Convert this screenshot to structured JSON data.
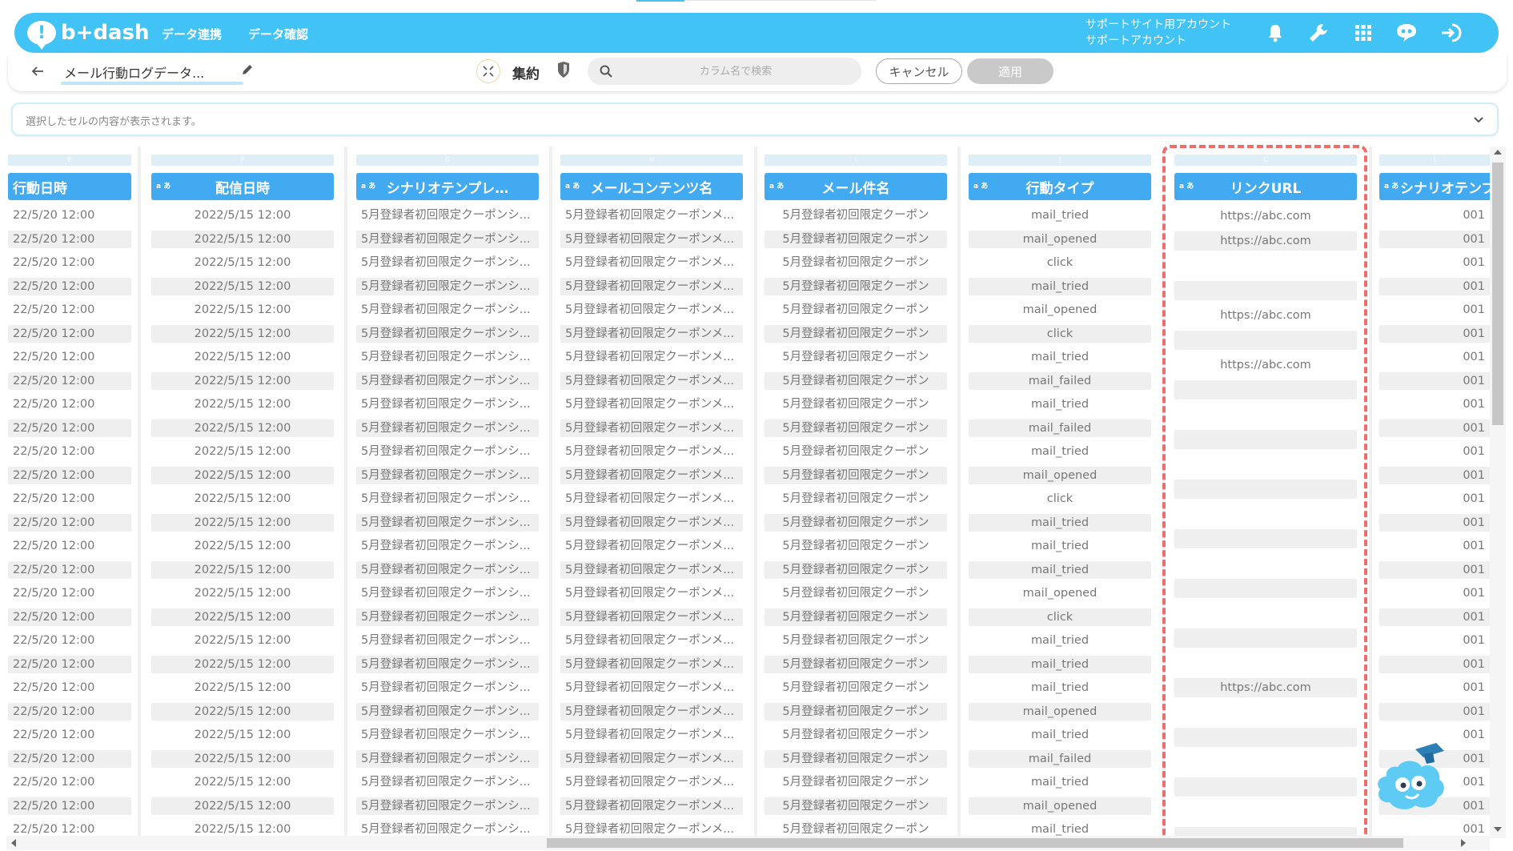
{
  "app": {
    "logo_text": "b+dash",
    "nav": [
      "データ連携",
      "データ確認"
    ],
    "account_line1": "サポートサイト用アカウント",
    "account_line2": "サポートアカウント"
  },
  "toolbar": {
    "title": "メール行動ログデータ...",
    "aggregate_label": "集約",
    "search_placeholder": "カラム名で検索",
    "cancel_label": "キャンセル",
    "apply_label": "適用"
  },
  "cell_viewer": {
    "placeholder": "選択したセルの内容が表示されます。"
  },
  "grid": {
    "type_badge": "a あ",
    "columns": [
      {
        "letter": "E",
        "name": "行動日時"
      },
      {
        "letter": "F",
        "name": "配信日時"
      },
      {
        "letter": "G",
        "name": "シナリオテンプレ…"
      },
      {
        "letter": "H",
        "name": "メールコンテンツ名"
      },
      {
        "letter": "I",
        "name": "メール件名"
      },
      {
        "letter": "J",
        "name": "行動タイプ"
      },
      {
        "letter": "C",
        "name": "リンクURL"
      },
      {
        "letter": "L",
        "name": "シナリオテンプ"
      }
    ],
    "rows": [
      [
        "22/5/20 12:00",
        "2022/5/15 12:00",
        "5月登録者初回限定クーポンシ...",
        "5月登録者初回限定クーポンメ...",
        "5月登録者初回限定クーポン",
        "mail_tried",
        "https://abc.com",
        "001"
      ],
      [
        "22/5/20 12:00",
        "2022/5/15 12:00",
        "5月登録者初回限定クーポンシ...",
        "5月登録者初回限定クーポンメ...",
        "5月登録者初回限定クーポン",
        "mail_opened",
        "https://abc.com",
        "001"
      ],
      [
        "22/5/20 12:00",
        "2022/5/15 12:00",
        "5月登録者初回限定クーポンシ...",
        "5月登録者初回限定クーポンメ...",
        "5月登録者初回限定クーポン",
        "click",
        "",
        "001"
      ],
      [
        "22/5/20 12:00",
        "2022/5/15 12:00",
        "5月登録者初回限定クーポンシ...",
        "5月登録者初回限定クーポンメ...",
        "5月登録者初回限定クーポン",
        "mail_tried",
        "",
        "001"
      ],
      [
        "22/5/20 12:00",
        "2022/5/15 12:00",
        "5月登録者初回限定クーポンシ...",
        "5月登録者初回限定クーポンメ...",
        "5月登録者初回限定クーポン",
        "mail_opened",
        "https://abc.com",
        "001"
      ],
      [
        "22/5/20 12:00",
        "2022/5/15 12:00",
        "5月登録者初回限定クーポンシ...",
        "5月登録者初回限定クーポンメ...",
        "5月登録者初回限定クーポン",
        "click",
        "",
        "001"
      ],
      [
        "22/5/20 12:00",
        "2022/5/15 12:00",
        "5月登録者初回限定クーポンシ...",
        "5月登録者初回限定クーポンメ...",
        "5月登録者初回限定クーポン",
        "mail_tried",
        "https://abc.com",
        "001"
      ],
      [
        "22/5/20 12:00",
        "2022/5/15 12:00",
        "5月登録者初回限定クーポンシ...",
        "5月登録者初回限定クーポンメ...",
        "5月登録者初回限定クーポン",
        "mail_failed",
        "",
        "001"
      ],
      [
        "22/5/20 12:00",
        "2022/5/15 12:00",
        "5月登録者初回限定クーポンシ...",
        "5月登録者初回限定クーポンメ...",
        "5月登録者初回限定クーポン",
        "mail_tried",
        "",
        "001"
      ],
      [
        "22/5/20 12:00",
        "2022/5/15 12:00",
        "5月登録者初回限定クーポンシ...",
        "5月登録者初回限定クーポンメ...",
        "5月登録者初回限定クーポン",
        "mail_failed",
        "",
        "001"
      ],
      [
        "22/5/20 12:00",
        "2022/5/15 12:00",
        "5月登録者初回限定クーポンシ...",
        "5月登録者初回限定クーポンメ...",
        "5月登録者初回限定クーポン",
        "mail_tried",
        "",
        "001"
      ],
      [
        "22/5/20 12:00",
        "2022/5/15 12:00",
        "5月登録者初回限定クーポンシ...",
        "5月登録者初回限定クーポンメ...",
        "5月登録者初回限定クーポン",
        "mail_opened",
        "",
        "001"
      ],
      [
        "22/5/20 12:00",
        "2022/5/15 12:00",
        "5月登録者初回限定クーポンシ...",
        "5月登録者初回限定クーポンメ...",
        "5月登録者初回限定クーポン",
        "click",
        "",
        "001"
      ],
      [
        "22/5/20 12:00",
        "2022/5/15 12:00",
        "5月登録者初回限定クーポンシ...",
        "5月登録者初回限定クーポンメ...",
        "5月登録者初回限定クーポン",
        "mail_tried",
        "",
        "001"
      ],
      [
        "22/5/20 12:00",
        "2022/5/15 12:00",
        "5月登録者初回限定クーポンシ...",
        "5月登録者初回限定クーポンメ...",
        "5月登録者初回限定クーポン",
        "mail_tried",
        "",
        "001"
      ],
      [
        "22/5/20 12:00",
        "2022/5/15 12:00",
        "5月登録者初回限定クーポンシ...",
        "5月登録者初回限定クーポンメ...",
        "5月登録者初回限定クーポン",
        "mail_tried",
        "",
        "001"
      ],
      [
        "22/5/20 12:00",
        "2022/5/15 12:00",
        "5月登録者初回限定クーポンシ...",
        "5月登録者初回限定クーポンメ...",
        "5月登録者初回限定クーポン",
        "mail_opened",
        "",
        "001"
      ],
      [
        "22/5/20 12:00",
        "2022/5/15 12:00",
        "5月登録者初回限定クーポンシ...",
        "5月登録者初回限定クーポンメ...",
        "5月登録者初回限定クーポン",
        "click",
        "",
        "001"
      ],
      [
        "22/5/20 12:00",
        "2022/5/15 12:00",
        "5月登録者初回限定クーポンシ...",
        "5月登録者初回限定クーポンメ...",
        "5月登録者初回限定クーポン",
        "mail_tried",
        "",
        "001"
      ],
      [
        "22/5/20 12:00",
        "2022/5/15 12:00",
        "5月登録者初回限定クーポンシ...",
        "5月登録者初回限定クーポンメ...",
        "5月登録者初回限定クーポン",
        "mail_tried",
        "https://abc.com",
        "001"
      ],
      [
        "22/5/20 12:00",
        "2022/5/15 12:00",
        "5月登録者初回限定クーポンシ...",
        "5月登録者初回限定クーポンメ...",
        "5月登録者初回限定クーポン",
        "mail_tried",
        "",
        "001"
      ],
      [
        "22/5/20 12:00",
        "2022/5/15 12:00",
        "5月登録者初回限定クーポンシ...",
        "5月登録者初回限定クーポンメ...",
        "5月登録者初回限定クーポン",
        "mail_opened",
        "",
        "001"
      ],
      [
        "22/5/20 12:00",
        "2022/5/15 12:00",
        "5月登録者初回限定クーポンシ...",
        "5月登録者初回限定クーポンメ...",
        "5月登録者初回限定クーポン",
        "mail_tried",
        "",
        "001"
      ],
      [
        "22/5/20 12:00",
        "2022/5/15 12:00",
        "5月登録者初回限定クーポンシ...",
        "5月登録者初回限定クーポンメ...",
        "5月登録者初回限定クーポン",
        "mail_failed",
        "",
        "001"
      ],
      [
        "22/5/20 12:00",
        "2022/5/15 12:00",
        "5月登録者初回限定クーポンシ...",
        "5月登録者初回限定クーポンメ...",
        "5月登録者初回限定クーポン",
        "mail_tried",
        "",
        "001"
      ],
      [
        "22/5/20 12:00",
        "2022/5/15 12:00",
        "5月登録者初回限定クーポンシ...",
        "5月登録者初回限定クーポンメ...",
        "5月登録者初回限定クーポン",
        "mail_opened",
        "",
        "001"
      ],
      [
        "22/5/20 12:00",
        "2022/5/15 12:00",
        "5月登録者初回限定クーポンシ...",
        "5月登録者初回限定クーポンメ...",
        "5月登録者初回限定クーポン",
        "mail_tried",
        "",
        "001"
      ]
    ]
  },
  "colors": {
    "brand": "#41c3f5",
    "column_header": "#41aaf0",
    "highlight": "#f26b6b",
    "apply_disabled": "#c9c9c9"
  },
  "icons": [
    "back-arrow-icon",
    "pencil-icon",
    "aggregate-icon",
    "shield-icon",
    "search-icon",
    "bell-icon",
    "wrench-icon",
    "grid-apps-icon",
    "chat-robot-icon",
    "logout-icon",
    "chevron-down-icon",
    "mascot-icon"
  ]
}
